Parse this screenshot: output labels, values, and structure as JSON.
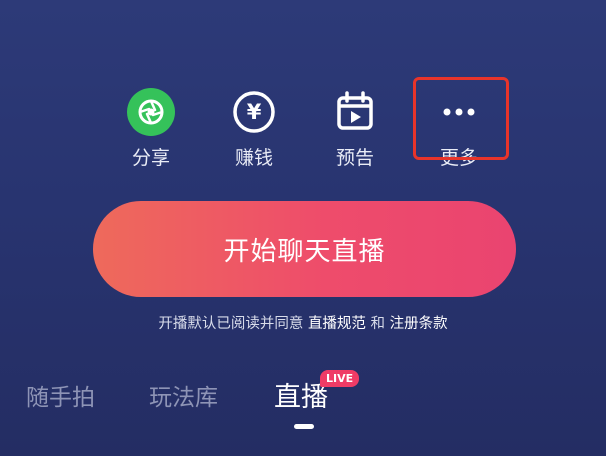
{
  "actions": {
    "share": {
      "label": "分享",
      "icon": "shutter-icon"
    },
    "earn": {
      "label": "赚钱",
      "symbol": "¥",
      "icon": "yen-coin-icon"
    },
    "preview": {
      "label": "预告",
      "icon": "calendar-play-icon"
    },
    "more": {
      "label": "更多",
      "icon": "ellipsis-icon"
    }
  },
  "start_button": {
    "label": "开始聊天直播"
  },
  "agreement": {
    "prefix": "开播默认已阅读并同意 ",
    "link1": "直播规范",
    "conj": " 和 ",
    "link2": "注册条款"
  },
  "tabs": [
    {
      "label": "随手拍"
    },
    {
      "label": "玩法库"
    },
    {
      "label": "直播",
      "badge": "LIVE",
      "active": true
    }
  ],
  "colors": {
    "background": "#2a3572",
    "share_green": "#35c25a",
    "accent_red": "#ee4c6b",
    "highlight_red": "#e8342a"
  }
}
